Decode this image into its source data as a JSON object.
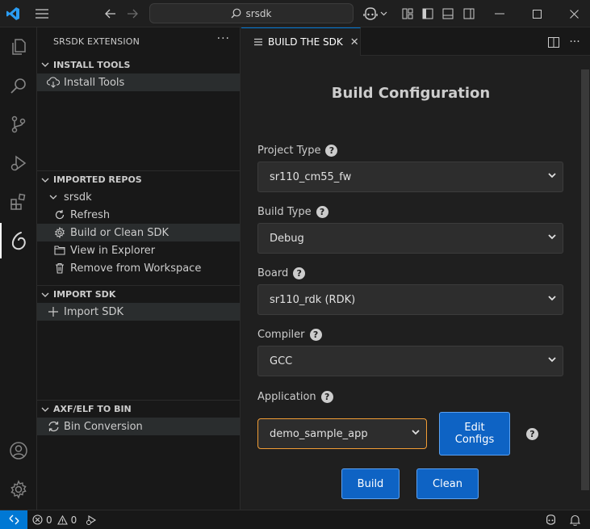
{
  "titlebar": {
    "search_text": "srsdk",
    "icons": [
      "vscode-logo-icon",
      "menu-icon",
      "back-arrow-icon",
      "forward-arrow-icon",
      "search-icon",
      "copilot-icon",
      "chevron-down-icon",
      "layout-icon",
      "toggle-sidebar-icon",
      "toggle-panel-icon",
      "toggle-secondary-sidebar-icon",
      "minimize-icon",
      "maximize-icon",
      "close-icon"
    ]
  },
  "activity_bar": {
    "items": [
      "explorer-icon",
      "search-icon",
      "source-control-icon",
      "run-debug-icon",
      "extensions-icon",
      "srsdk-extension-icon"
    ],
    "bottom": [
      "account-icon",
      "settings-gear-icon"
    ]
  },
  "sidebar": {
    "title": "SRSDK EXTENSION",
    "more": "···",
    "sections": {
      "install_tools": {
        "header": "INSTALL TOOLS",
        "items": [
          {
            "label": "Install Tools"
          }
        ]
      },
      "imported_repos": {
        "header": "IMPORTED REPOS",
        "repo": "srsdk",
        "items": [
          {
            "label": "Refresh"
          },
          {
            "label": "Build or Clean SDK"
          },
          {
            "label": "View in Explorer"
          },
          {
            "label": "Remove from Workspace"
          }
        ]
      },
      "import_sdk": {
        "header": "IMPORT SDK",
        "items": [
          {
            "label": "Import SDK"
          }
        ]
      },
      "axf_to_bin": {
        "header": "AXF/ELF TO BIN",
        "items": [
          {
            "label": "Bin Conversion"
          }
        ]
      }
    }
  },
  "editor": {
    "tab": {
      "label": "BUILD THE SDK",
      "close": "✕"
    },
    "panel": {
      "title": "Build Configuration",
      "help": "?",
      "fields": {
        "project_type": {
          "label": "Project Type",
          "value": "sr110_cm55_fw"
        },
        "build_type": {
          "label": "Build Type",
          "value": "Debug"
        },
        "board": {
          "label": "Board",
          "value": "sr110_rdk (RDK)"
        },
        "compiler": {
          "label": "Compiler",
          "value": "GCC"
        },
        "application": {
          "label": "Application",
          "value": "demo_sample_app"
        }
      },
      "buttons": {
        "edit_configs_line1": "Edit",
        "edit_configs_line2": "Configs",
        "build": "Build",
        "clean": "Clean"
      }
    }
  },
  "statusbar": {
    "errors": "0",
    "warnings": "0"
  },
  "colors": {
    "accent": "#0078d4",
    "button_bg": "#0e63c4",
    "focus_border": "#f29d35",
    "sidebar_bg": "#181818",
    "editor_bg": "#1f1f1f"
  }
}
